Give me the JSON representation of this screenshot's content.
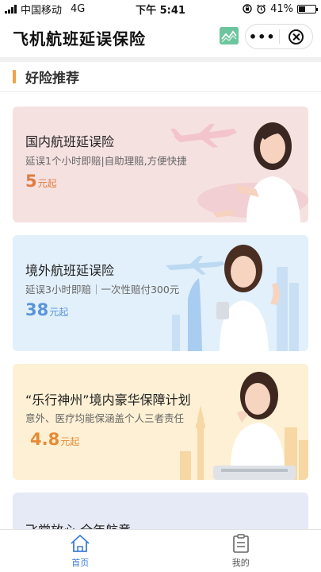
{
  "status_bar": {
    "carrier": "中国移动",
    "network": "4G",
    "time": "下午 5:41",
    "battery": "41%",
    "battery_level": 0.41
  },
  "nav": {
    "title": "飞机航班延误保险",
    "more_label": "•••"
  },
  "section": {
    "title": "好险推荐"
  },
  "products": [
    {
      "title": "国内航班延误险",
      "desc": "延误1个小时即赔|自助理赔,方便快捷",
      "price": "5",
      "unit": "元起"
    },
    {
      "title": "境外航班延误险",
      "desc": "延误3小时即赔｜一次性赔付300元",
      "price": "38",
      "unit": "元起"
    },
    {
      "title": "“乐行神州”境内豪华保障计划",
      "desc": "意外、医疗均能保涵盖个人三者责任",
      "price": "4.8",
      "unit": "元起"
    },
    {
      "title": "飞常放心·全年航意"
    }
  ],
  "tabs": [
    {
      "label": "首页",
      "icon": "home-icon",
      "active": true
    },
    {
      "label": "我的",
      "icon": "clipboard-icon",
      "active": false
    }
  ],
  "colors": {
    "accent_orange": "#f0a24a",
    "price_orange": "#e07c3f",
    "price_blue": "#5b95d8",
    "tab_active": "#3e7ed5"
  }
}
